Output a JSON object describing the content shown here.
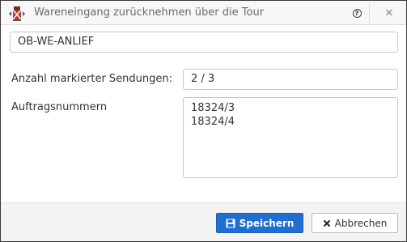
{
  "window": {
    "title": "Wareneingang zurücknehmen über die Tour",
    "app_icon": "truck-cancel-icon",
    "help_glyph": "?",
    "close_glyph": "✕"
  },
  "form": {
    "tour_value": "OB-WE-ANLIEF",
    "count_label": "Anzahl markierter Sendungen:",
    "count_value": "2 / 3",
    "orders_label": "Auftragsnummern",
    "orders": [
      "18324/3",
      "18324/4"
    ]
  },
  "footer": {
    "save_label": "Speichern",
    "save_icon": "save-icon",
    "cancel_label": "Abbrechen",
    "cancel_icon": "close-icon"
  },
  "colors": {
    "primary": "#1f6fd0",
    "icon_red": "#c0392b",
    "icon_blue": "#2c5aa0"
  }
}
